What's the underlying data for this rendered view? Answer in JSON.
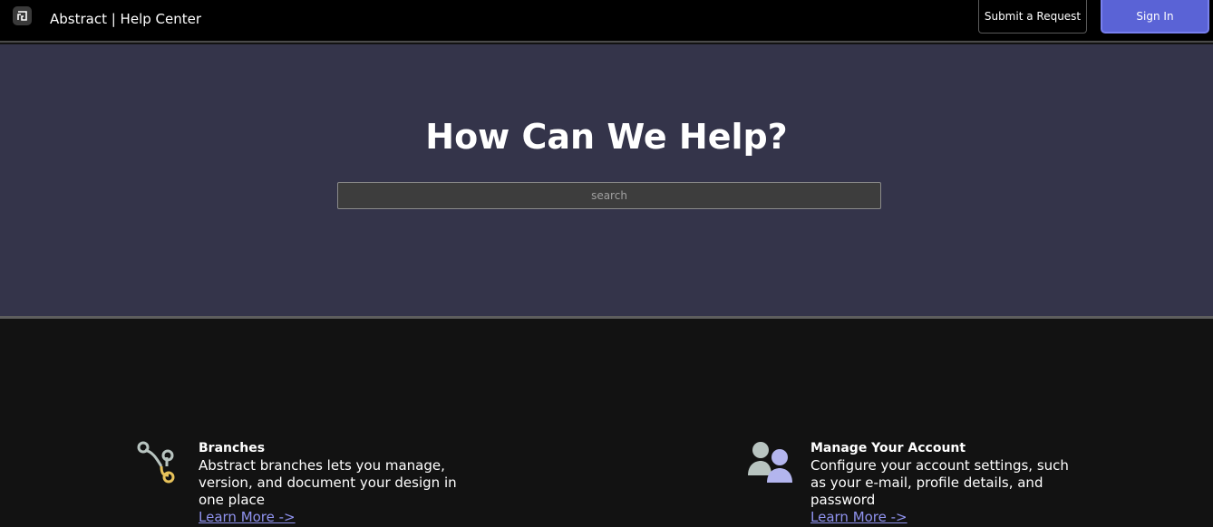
{
  "header": {
    "logo_icon": "abstract-logo-icon",
    "brand": "Abstract | Help Center",
    "submit_label": "Submit a Request",
    "signin_label": "Sign In"
  },
  "hero": {
    "title": "How Can We Help?",
    "search_placeholder": "search"
  },
  "cards": [
    {
      "icon": "branches-icon",
      "title": "Branches",
      "description": "Abstract branches lets you manage, version, and document your design in one place",
      "link": "Learn More ->"
    },
    {
      "icon": "users-icon",
      "title": "Manage Your Account",
      "description": "Configure your account settings, such as your e-mail, profile details, and password",
      "link": "Learn More ->"
    }
  ],
  "colors": {
    "accent": "#5a63d6",
    "link": "#8f92ee",
    "hero_bg": "#34344a"
  }
}
